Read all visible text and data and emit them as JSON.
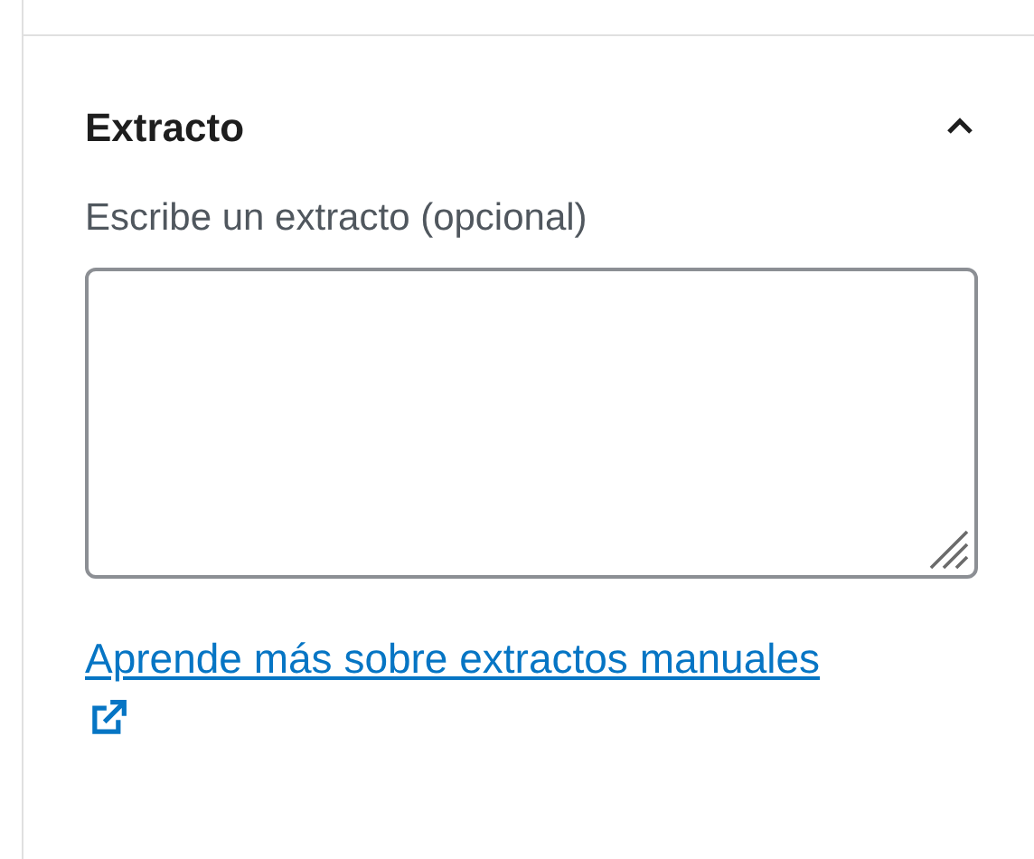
{
  "panel": {
    "title": "Extracto",
    "expanded": true,
    "field_label": "Escribe un extracto (opcional)",
    "link": "Aprende más sobre extractos manuales"
  }
}
